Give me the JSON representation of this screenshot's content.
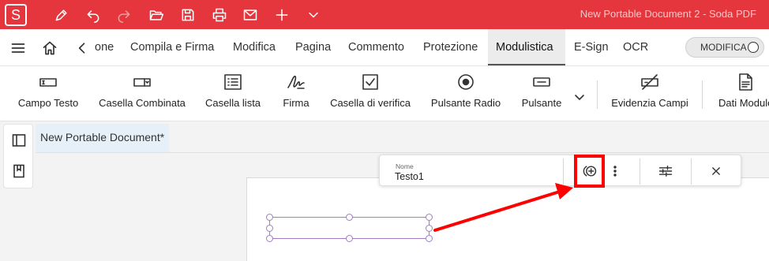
{
  "window": {
    "title": "New Portable Document 2  -   Soda PDF",
    "logo_letter": "S",
    "quick_access": [
      "pen-icon",
      "undo-icon",
      "redo-icon",
      "open-folder-icon",
      "save-icon",
      "print-icon",
      "mail-icon",
      "plus-icon",
      "chevron-down-icon"
    ]
  },
  "menu": {
    "tabs": [
      {
        "label": "one"
      },
      {
        "label": "Compila e Firma"
      },
      {
        "label": "Modifica"
      },
      {
        "label": "Pagina"
      },
      {
        "label": "Commento"
      },
      {
        "label": "Protezione"
      },
      {
        "label": "Modulistica"
      },
      {
        "label": "E-Sign"
      },
      {
        "label": "OCR"
      }
    ],
    "active_tab": "Modulistica",
    "mode_toggle_label": "MODIFICA"
  },
  "ribbon": {
    "items": [
      {
        "label": "Campo Testo",
        "icon": "text-field-icon"
      },
      {
        "label": "Casella Combinata",
        "icon": "combo-box-icon"
      },
      {
        "label": "Casella lista",
        "icon": "list-box-icon"
      },
      {
        "label": "Firma",
        "icon": "signature-icon"
      },
      {
        "label": "Casella di verifica",
        "icon": "checkbox-icon"
      },
      {
        "label": "Pulsante Radio",
        "icon": "radio-button-icon"
      },
      {
        "label": "Pulsante",
        "icon": "button-icon"
      },
      {
        "label": "Evidenzia Campi",
        "icon": "highlight-fields-icon"
      },
      {
        "label": "Dati Modulo",
        "icon": "form-data-icon"
      }
    ]
  },
  "document": {
    "tab_label": "New Portable Document*"
  },
  "field_toolbar": {
    "name_label": "Nome",
    "name_value": "Testo1"
  },
  "colors": {
    "titlebar": "#e5363d",
    "highlight": "#ff0000",
    "field_border": "#a07cc5"
  }
}
